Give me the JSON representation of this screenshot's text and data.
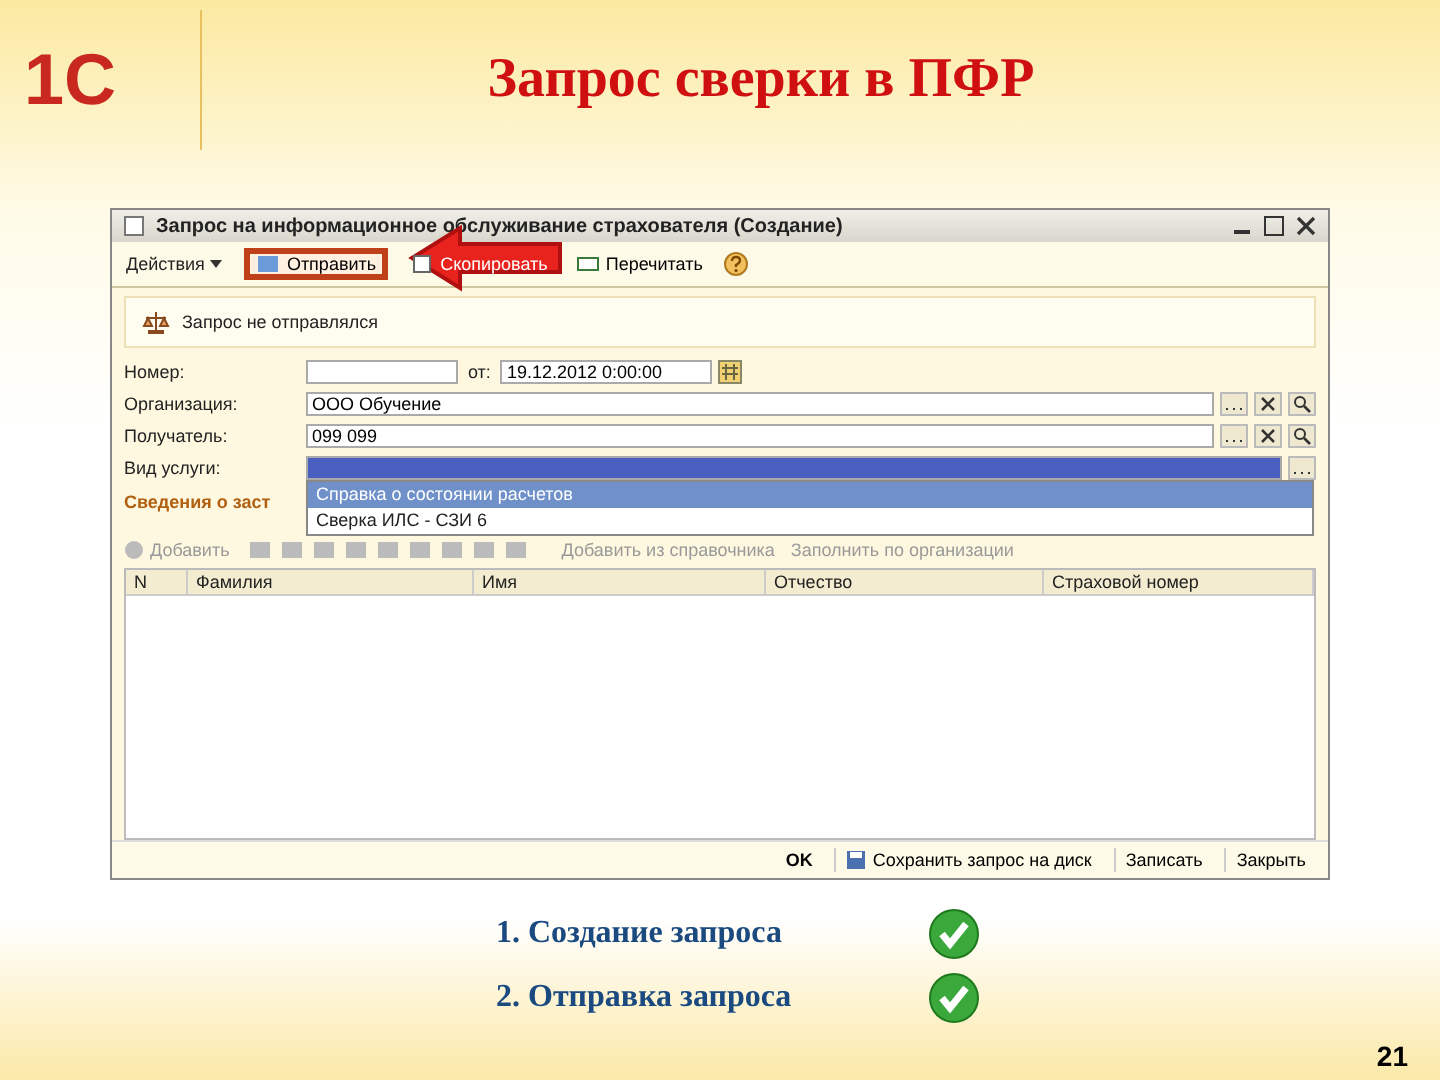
{
  "slide": {
    "logo": "1С",
    "title": "Запрос сверки в ПФР",
    "page_number": "21"
  },
  "window": {
    "title": "Запрос на информационное обслуживание страхователя (Создание)",
    "toolbar": [
      {
        "label": "Действия",
        "kind": "menu",
        "highlighted": false
      },
      {
        "label": "Отправить",
        "kind": "send",
        "highlighted": true
      },
      {
        "label": "Скопировать",
        "kind": "copy",
        "highlighted": false
      },
      {
        "label": "Перечитать",
        "kind": "reread",
        "highlighted": false
      },
      {
        "kind": "help",
        "highlighted": false
      }
    ],
    "status": "Запрос не отправлялся",
    "fields": [
      {
        "label": "Номер:",
        "date_label": "от:",
        "date": "19.12.2012 0:00:00",
        "kind": "number"
      },
      {
        "label": "Организация:",
        "value": "ООО Обучение",
        "kind": "ref"
      },
      {
        "label": "Получатель:",
        "value": "099 099",
        "kind": "ref"
      },
      {
        "label": "Вид услуги:",
        "kind": "select"
      }
    ],
    "dropdown": [
      {
        "label": "Справка о состоянии расчетов",
        "selected": true
      },
      {
        "label": "Сверка ИЛС - СЗИ 6",
        "selected": false
      }
    ],
    "section_title": "Сведения о заст",
    "table_toolbar": [
      {
        "label": "Добавить",
        "kind": "add"
      },
      {
        "kind": "icons"
      },
      {
        "label": "Добавить из справочника",
        "kind": "text"
      },
      {
        "label": "Заполнить по организации",
        "kind": "text"
      }
    ],
    "table": {
      "columns": [
        "N",
        "Фамилия",
        "Имя",
        "Отчество",
        "Страховой номер"
      ]
    },
    "buttons": [
      {
        "label": "OK",
        "kind": "ok"
      },
      {
        "label": "Сохранить запрос на диск",
        "kind": "save"
      },
      {
        "label": "Записать",
        "kind": "plain"
      },
      {
        "label": "Закрыть",
        "kind": "plain"
      }
    ]
  },
  "steps": [
    {
      "label": "1. Создание запроса",
      "done": true
    },
    {
      "label": "2. Отправка запроса",
      "done": true
    }
  ]
}
